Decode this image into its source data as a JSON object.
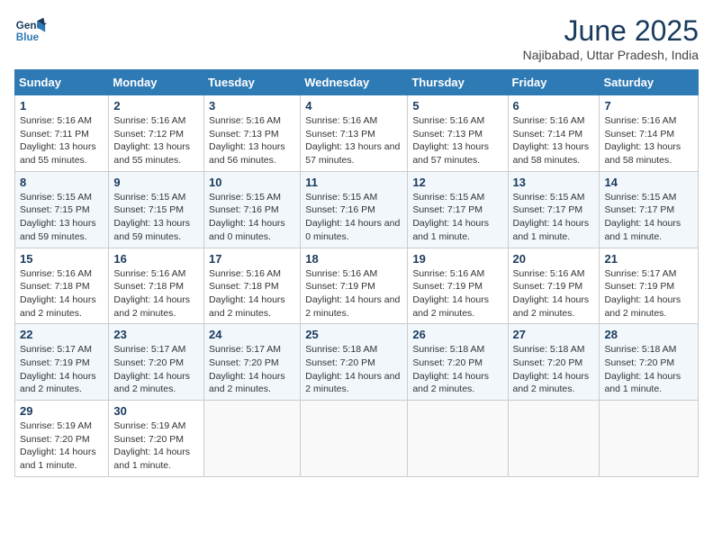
{
  "logo": {
    "line1": "General",
    "line2": "Blue"
  },
  "title": "June 2025",
  "location": "Najibabad, Uttar Pradesh, India",
  "weekdays": [
    "Sunday",
    "Monday",
    "Tuesday",
    "Wednesday",
    "Thursday",
    "Friday",
    "Saturday"
  ],
  "weeks": [
    [
      {
        "day": "1",
        "sunrise": "5:16 AM",
        "sunset": "7:11 PM",
        "daylight": "13 hours and 55 minutes."
      },
      {
        "day": "2",
        "sunrise": "5:16 AM",
        "sunset": "7:12 PM",
        "daylight": "13 hours and 55 minutes."
      },
      {
        "day": "3",
        "sunrise": "5:16 AM",
        "sunset": "7:13 PM",
        "daylight": "13 hours and 56 minutes."
      },
      {
        "day": "4",
        "sunrise": "5:16 AM",
        "sunset": "7:13 PM",
        "daylight": "13 hours and 57 minutes."
      },
      {
        "day": "5",
        "sunrise": "5:16 AM",
        "sunset": "7:13 PM",
        "daylight": "13 hours and 57 minutes."
      },
      {
        "day": "6",
        "sunrise": "5:16 AM",
        "sunset": "7:14 PM",
        "daylight": "13 hours and 58 minutes."
      },
      {
        "day": "7",
        "sunrise": "5:16 AM",
        "sunset": "7:14 PM",
        "daylight": "13 hours and 58 minutes."
      }
    ],
    [
      {
        "day": "8",
        "sunrise": "5:15 AM",
        "sunset": "7:15 PM",
        "daylight": "13 hours and 59 minutes."
      },
      {
        "day": "9",
        "sunrise": "5:15 AM",
        "sunset": "7:15 PM",
        "daylight": "13 hours and 59 minutes."
      },
      {
        "day": "10",
        "sunrise": "5:15 AM",
        "sunset": "7:16 PM",
        "daylight": "14 hours and 0 minutes."
      },
      {
        "day": "11",
        "sunrise": "5:15 AM",
        "sunset": "7:16 PM",
        "daylight": "14 hours and 0 minutes."
      },
      {
        "day": "12",
        "sunrise": "5:15 AM",
        "sunset": "7:17 PM",
        "daylight": "14 hours and 1 minute."
      },
      {
        "day": "13",
        "sunrise": "5:15 AM",
        "sunset": "7:17 PM",
        "daylight": "14 hours and 1 minute."
      },
      {
        "day": "14",
        "sunrise": "5:15 AM",
        "sunset": "7:17 PM",
        "daylight": "14 hours and 1 minute."
      }
    ],
    [
      {
        "day": "15",
        "sunrise": "5:16 AM",
        "sunset": "7:18 PM",
        "daylight": "14 hours and 2 minutes."
      },
      {
        "day": "16",
        "sunrise": "5:16 AM",
        "sunset": "7:18 PM",
        "daylight": "14 hours and 2 minutes."
      },
      {
        "day": "17",
        "sunrise": "5:16 AM",
        "sunset": "7:18 PM",
        "daylight": "14 hours and 2 minutes."
      },
      {
        "day": "18",
        "sunrise": "5:16 AM",
        "sunset": "7:19 PM",
        "daylight": "14 hours and 2 minutes."
      },
      {
        "day": "19",
        "sunrise": "5:16 AM",
        "sunset": "7:19 PM",
        "daylight": "14 hours and 2 minutes."
      },
      {
        "day": "20",
        "sunrise": "5:16 AM",
        "sunset": "7:19 PM",
        "daylight": "14 hours and 2 minutes."
      },
      {
        "day": "21",
        "sunrise": "5:17 AM",
        "sunset": "7:19 PM",
        "daylight": "14 hours and 2 minutes."
      }
    ],
    [
      {
        "day": "22",
        "sunrise": "5:17 AM",
        "sunset": "7:19 PM",
        "daylight": "14 hours and 2 minutes."
      },
      {
        "day": "23",
        "sunrise": "5:17 AM",
        "sunset": "7:20 PM",
        "daylight": "14 hours and 2 minutes."
      },
      {
        "day": "24",
        "sunrise": "5:17 AM",
        "sunset": "7:20 PM",
        "daylight": "14 hours and 2 minutes."
      },
      {
        "day": "25",
        "sunrise": "5:18 AM",
        "sunset": "7:20 PM",
        "daylight": "14 hours and 2 minutes."
      },
      {
        "day": "26",
        "sunrise": "5:18 AM",
        "sunset": "7:20 PM",
        "daylight": "14 hours and 2 minutes."
      },
      {
        "day": "27",
        "sunrise": "5:18 AM",
        "sunset": "7:20 PM",
        "daylight": "14 hours and 2 minutes."
      },
      {
        "day": "28",
        "sunrise": "5:18 AM",
        "sunset": "7:20 PM",
        "daylight": "14 hours and 1 minute."
      }
    ],
    [
      {
        "day": "29",
        "sunrise": "5:19 AM",
        "sunset": "7:20 PM",
        "daylight": "14 hours and 1 minute."
      },
      {
        "day": "30",
        "sunrise": "5:19 AM",
        "sunset": "7:20 PM",
        "daylight": "14 hours and 1 minute."
      },
      null,
      null,
      null,
      null,
      null
    ]
  ]
}
